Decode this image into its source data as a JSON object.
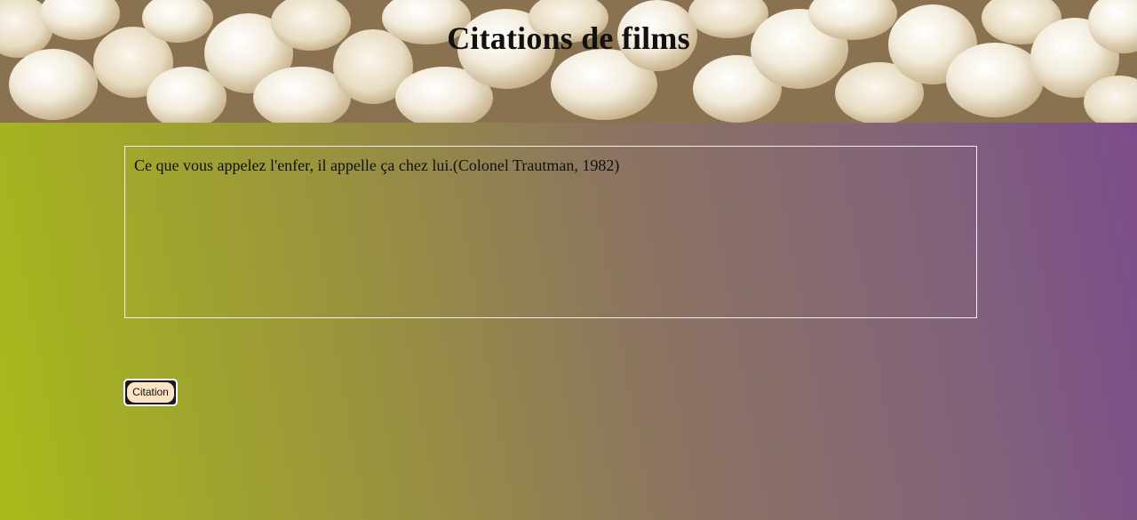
{
  "header": {
    "title": "Citations de films"
  },
  "quote": {
    "text": "Ce que vous appelez l'enfer, il appelle ça chez lui.(Colonel Trautman, 1982)"
  },
  "controls": {
    "citation_label": "Citation"
  },
  "colors": {
    "gradient_left": "#a8ba1a",
    "gradient_right": "#7a4a8c",
    "button_fill": "#fbe3c4"
  }
}
